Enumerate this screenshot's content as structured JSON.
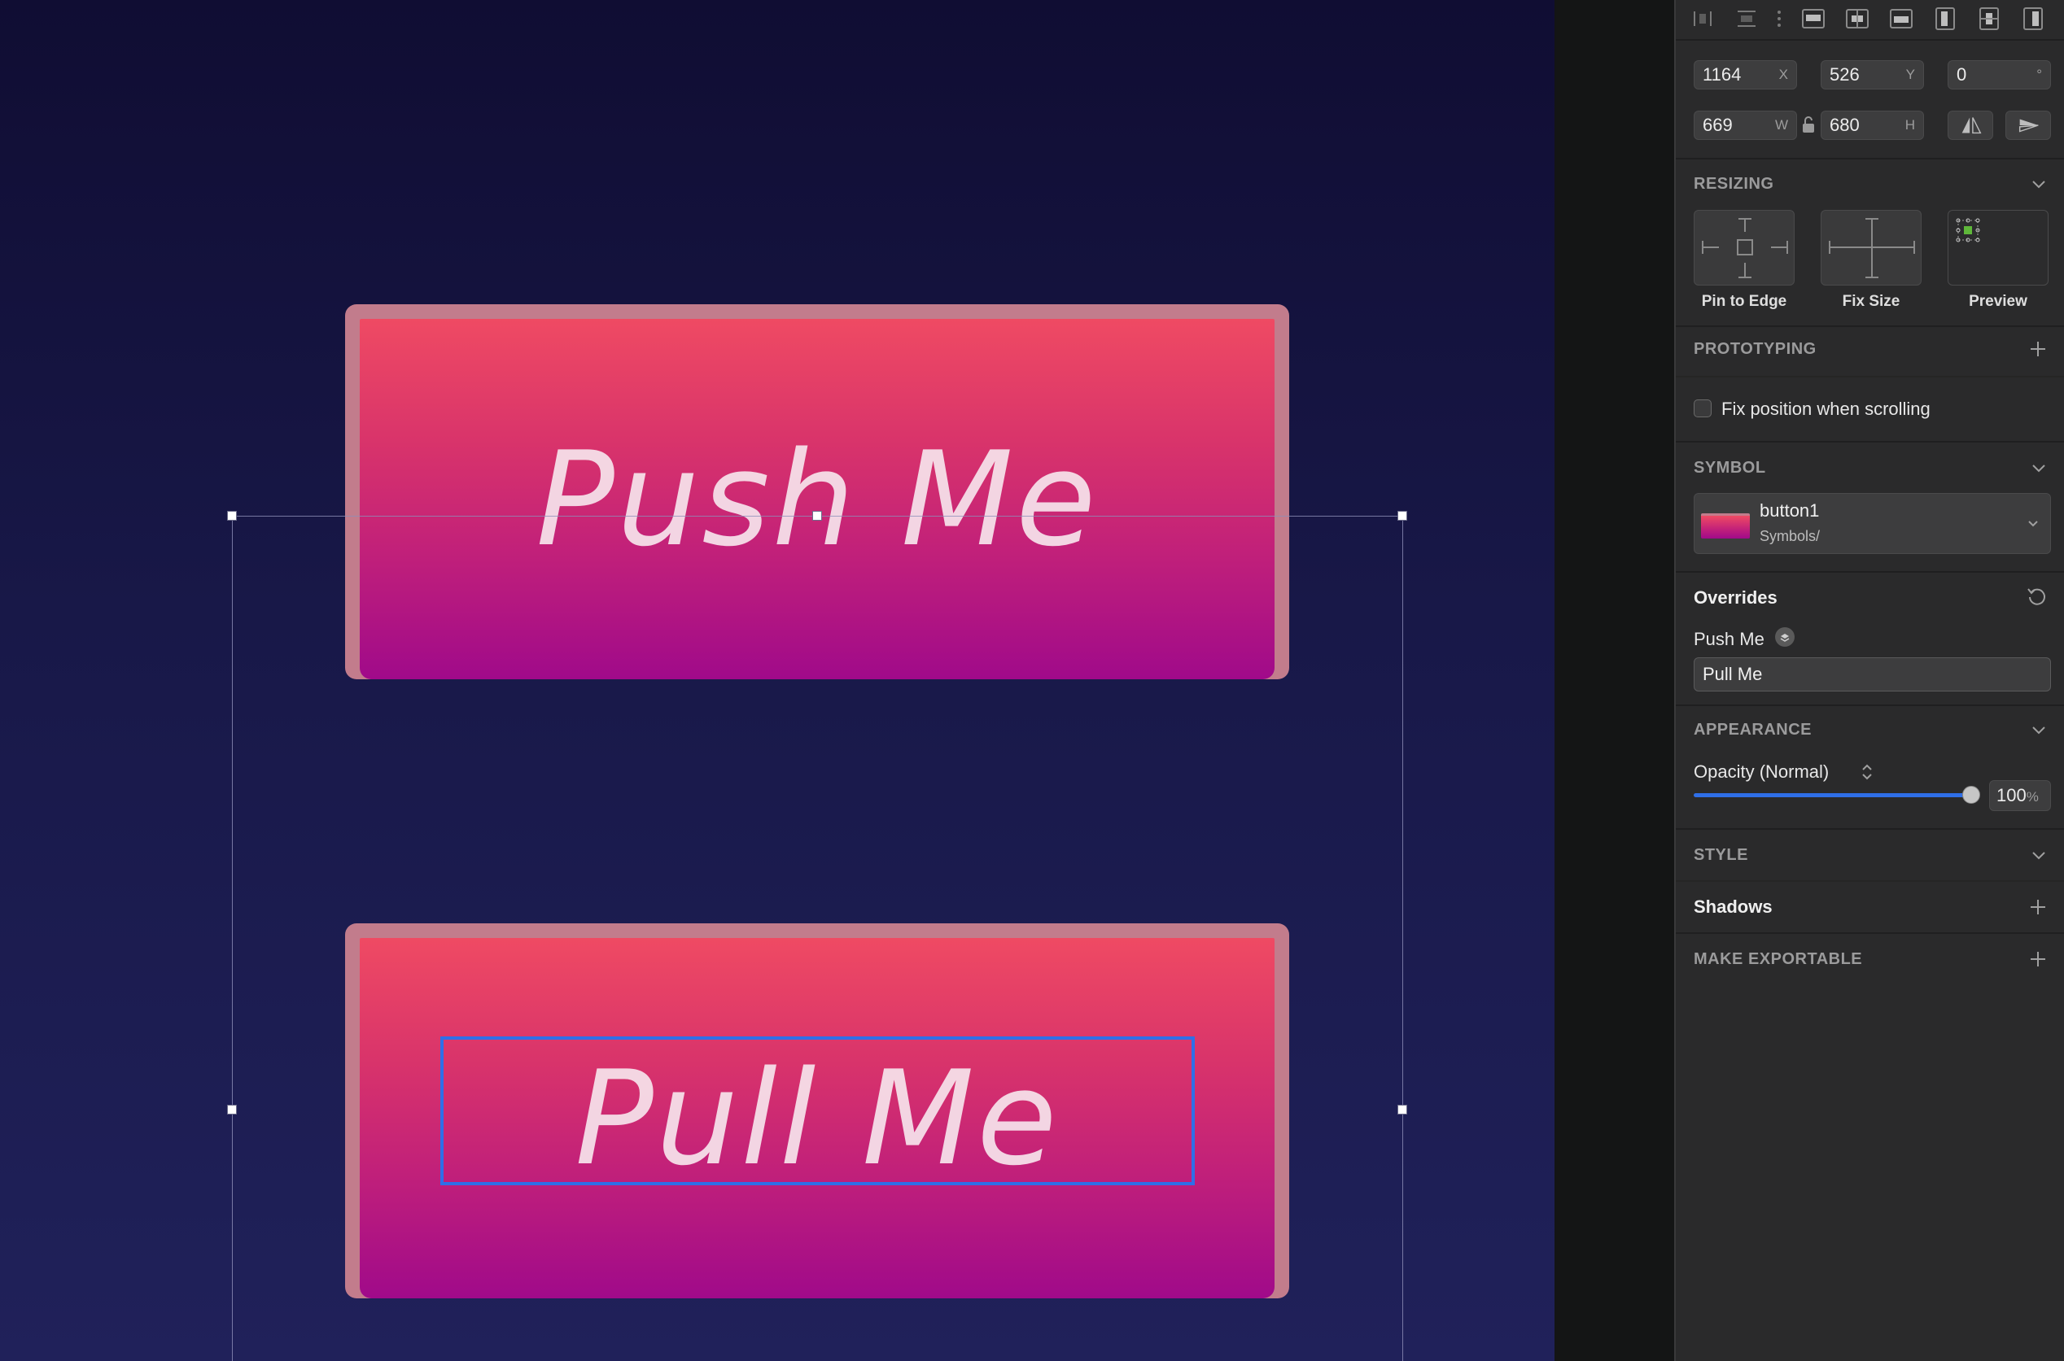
{
  "canvas": {
    "buttons": [
      {
        "label": "Push Me"
      },
      {
        "label": "Pull Me"
      }
    ]
  },
  "inspector": {
    "position": {
      "x": "1164",
      "x_unit": "X",
      "y": "526",
      "y_unit": "Y",
      "rotation": "0",
      "rotation_unit": "°"
    },
    "size": {
      "w": "669",
      "w_unit": "W",
      "h": "680",
      "h_unit": "H"
    },
    "resizing": {
      "title": "RESIZING",
      "options": [
        "Pin to Edge",
        "Fix Size",
        "Preview"
      ]
    },
    "prototyping": {
      "title": "PROTOTYPING",
      "fix_position_label": "Fix position when scrolling",
      "fix_position_checked": false
    },
    "symbol": {
      "title": "SYMBOL",
      "name": "button1",
      "path": "Symbols/"
    },
    "overrides": {
      "title": "Overrides",
      "item_label": "Push Me",
      "item_value": "Pull Me"
    },
    "appearance": {
      "title": "APPEARANCE",
      "opacity_label": "Opacity (Normal)",
      "opacity_value": "100",
      "opacity_unit": "%",
      "opacity_fraction": 1.0
    },
    "style": {
      "title": "STYLE"
    },
    "shadows": {
      "title": "Shadows"
    },
    "export": {
      "title": "MAKE EXPORTABLE"
    }
  },
  "colors": {
    "accent": "#2f6fe8",
    "button_top": "#ef4a63",
    "button_bottom": "#a00a8a",
    "button_border": "#c27c8c",
    "canvas_bg_top": "#100d33",
    "canvas_bg_bottom": "#20215a"
  }
}
